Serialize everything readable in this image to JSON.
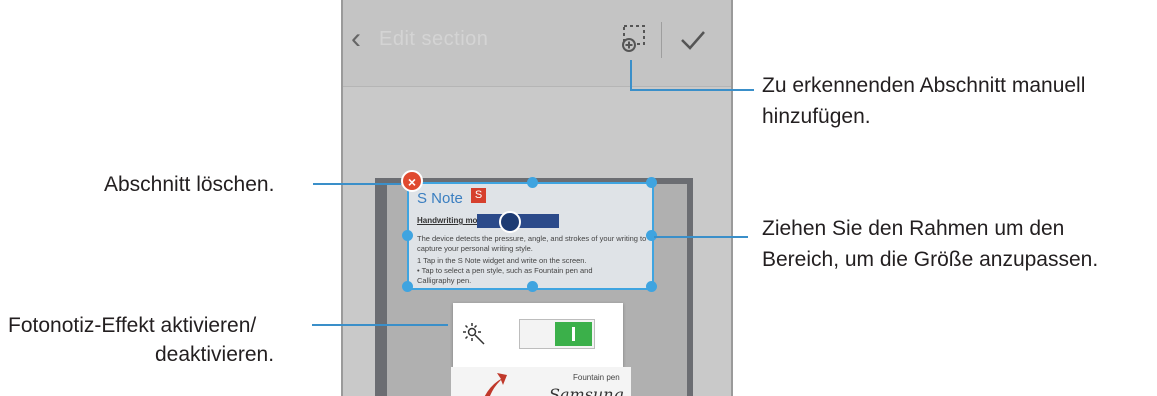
{
  "colors": {
    "accent": "#3a8fc9",
    "selection": "#3fa4e0",
    "delete": "#e04a2f",
    "switch_on": "#3bb04a"
  },
  "screen": {
    "action_bar": {
      "back_icon": "chevron-left-icon",
      "title": "Edit section",
      "add_section_icon": "add-section-icon",
      "done_icon": "check-icon"
    },
    "note": {
      "title": "S Note",
      "badge": "S",
      "handwriting_label": "Handwriting mode",
      "lines": [
        "The device detects the pressure, angle, and strokes of your writing to",
        "capture your personal writing style.",
        "1  Tap   in the S Note widget and write on the screen.",
        "   • Tap   to select a pen style, such as Fountain pen and",
        "   Calligraphy pen."
      ]
    },
    "delete_icon": "close-icon",
    "photo_note_effect": {
      "icon": "sun-icon",
      "state": "on"
    },
    "sketch": {
      "label": "Fountain pen",
      "signature": "Samsung"
    }
  },
  "callouts": {
    "add_section": "Zu erkennenden Abschnitt manuell hinzufügen.",
    "add_section_line1": "Zu erkennenden Abschnitt manuell",
    "add_section_line2": "hinzufügen.",
    "delete_section": "Abschnitt löschen.",
    "resize_line1": "Ziehen Sie den Rahmen um den",
    "resize_line2": "Bereich, um die Größe anzupassen.",
    "photo_effect_line1": "Fotonotiz-Effekt aktivieren/",
    "photo_effect_line2": "deaktivieren."
  }
}
